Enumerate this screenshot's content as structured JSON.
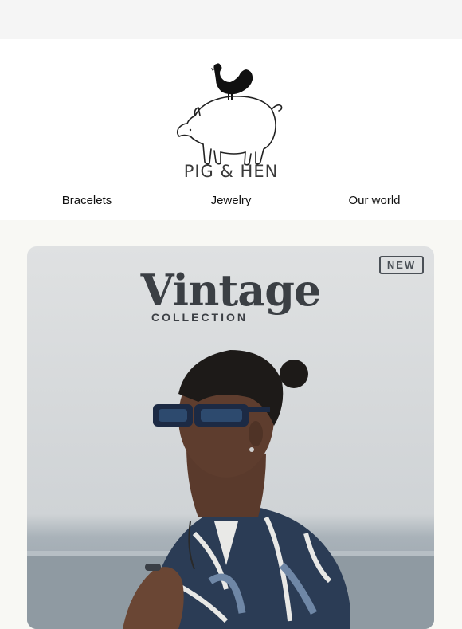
{
  "brand": {
    "name": "PIG & HEN"
  },
  "nav": {
    "items": [
      "Bracelets",
      "Jewelry",
      "Our world"
    ]
  },
  "hero": {
    "badge": "NEW",
    "title": "Vintage",
    "subtitle": "COLLECTION"
  },
  "colors": {
    "header_bg": "#ffffff",
    "page_bg": "#f8f8f4",
    "text": "#111111",
    "hero_text": "#3b3f44"
  }
}
